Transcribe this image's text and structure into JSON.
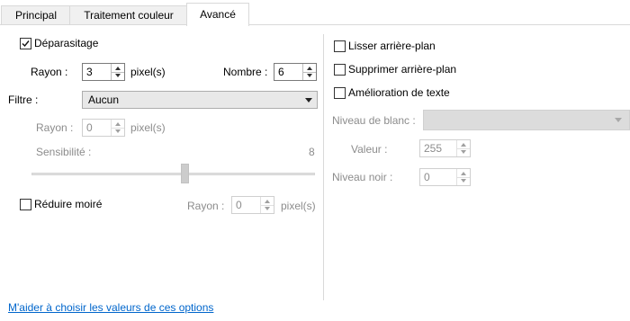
{
  "tabs": [
    {
      "label": "Principal"
    },
    {
      "label": "Traitement couleur"
    },
    {
      "label": "Avancé"
    }
  ],
  "left": {
    "deparasitage": {
      "label": "Déparasitage",
      "checked": true
    },
    "rayon": {
      "label": "Rayon :",
      "value": "3",
      "unit": "pixel(s)"
    },
    "nombre": {
      "label": "Nombre :",
      "value": "6"
    },
    "filtre": {
      "label": "Filtre :",
      "value": "Aucun"
    },
    "rayon2": {
      "label": "Rayon :",
      "value": "0",
      "unit": "pixel(s)"
    },
    "sensibilite": {
      "label": "Sensibilité :",
      "value": "8",
      "level": 0.55
    },
    "reduire_moire": {
      "label": "Réduire moiré",
      "checked": false
    },
    "rayon3": {
      "label": "Rayon :",
      "value": "0",
      "unit": "pixel(s)"
    }
  },
  "right": {
    "lisser": {
      "label": "Lisser arrière-plan",
      "checked": false
    },
    "supprimer": {
      "label": "Supprimer arrière-plan",
      "checked": false
    },
    "amelioration": {
      "label": "Amélioration de texte",
      "checked": false
    },
    "niveau_blanc": {
      "label": "Niveau de blanc :",
      "value": ""
    },
    "valeur": {
      "label": "Valeur :",
      "value": "255"
    },
    "niveau_noir": {
      "label": "Niveau noir :",
      "value": "0"
    }
  },
  "help_link": "M'aider à choisir les valeurs de ces options"
}
